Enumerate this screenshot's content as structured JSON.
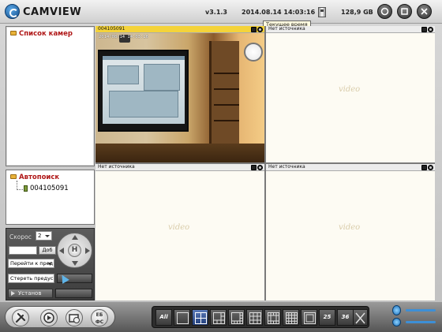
{
  "app": {
    "title": "CAMVIEW",
    "version": "v3.1.3",
    "datetime": "2014.08.14  14:03:16",
    "disk_free": "128,9 GB",
    "window_buttons": [
      "minimize-icon",
      "restore-icon",
      "close-icon"
    ]
  },
  "tooltip": "Текущее время",
  "sidebar": {
    "camera_list_title": "Список камер",
    "autosearch_title": "Автопоиск",
    "autosearch_items": [
      "004105091"
    ]
  },
  "ptz": {
    "speed_label": "Скорос",
    "speed_value": "2",
    "add_label": "Доб",
    "goto_label": "Перейти к пред",
    "clear_label": "Стереть предус",
    "install_label": "Установ",
    "center_glyph": "H"
  },
  "tiles": [
    {
      "label": "004105091",
      "active": true,
      "timestamp": "2014/08/14 14:03:16"
    },
    {
      "label": "Нет источника",
      "active": false,
      "watermark": "video"
    },
    {
      "label": "Нет источника",
      "active": false,
      "watermark": "video"
    },
    {
      "label": "Нет источника",
      "active": false,
      "watermark": "video"
    }
  ],
  "toolbar": {
    "tools": [
      "settings-icon",
      "playback-icon",
      "record-icon"
    ],
    "lang_top": "ЕБ",
    "lang_bottom": "ФС",
    "layouts": [
      "All",
      "1",
      "4",
      "6",
      "8",
      "9",
      "13",
      "16",
      "fullscreen-grid",
      "25",
      "36",
      "fullscreen"
    ],
    "selected_layout": "4",
    "layout_25": "25",
    "layout_36": "36",
    "layout_all": "All"
  },
  "colors": {
    "active_tile": "#f4d33a",
    "list_title": "#b01818",
    "selected_layout": "#2f5199"
  }
}
